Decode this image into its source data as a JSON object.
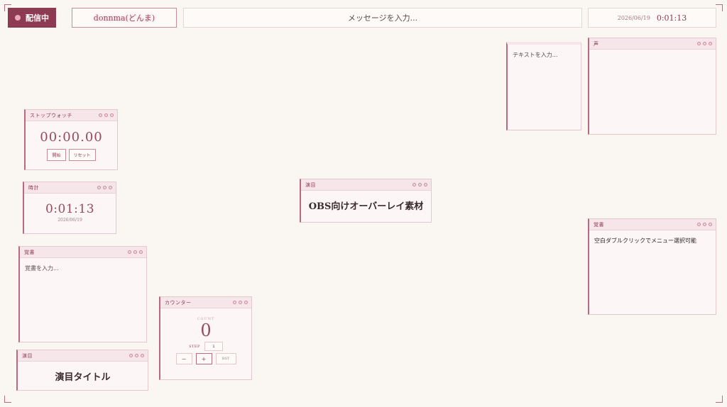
{
  "header": {
    "live_label": "配信中",
    "streamer_name": "donnma(どんま)",
    "message_placeholder": "メッセージを入力...",
    "date": "2026/06/19",
    "time": "0:01:13"
  },
  "stopwatch": {
    "title": "ストップウォッチ",
    "time": "00:00.00",
    "start_label": "開始",
    "reset_label": "リセット"
  },
  "clock": {
    "title": "時計",
    "time": "0:01:13",
    "date": "2026/06/19"
  },
  "memo_left": {
    "title": "覚書",
    "placeholder": "覚書を入力..."
  },
  "program_bottom": {
    "title": "演目",
    "text": "演目タイトル"
  },
  "counter": {
    "title": "カウンター",
    "count_label": "COUNT",
    "value": "0",
    "step_label": "STEP",
    "step_value": "1",
    "minus_label": "−",
    "plus_label": "+",
    "reset_label": "RST"
  },
  "program_center": {
    "title": "演目",
    "text": "OBS向けオーバーレイ素材"
  },
  "text_widget": {
    "placeholder": "テキストを入力..."
  },
  "voice": {
    "title": "声"
  },
  "memo_right": {
    "title": "覚書",
    "text": "空白ダブルクリックでメニュー選択可能"
  },
  "colors": {
    "accent": "#8e3a52",
    "background": "#faf6f2",
    "widget_header": "#f6e6ea"
  }
}
